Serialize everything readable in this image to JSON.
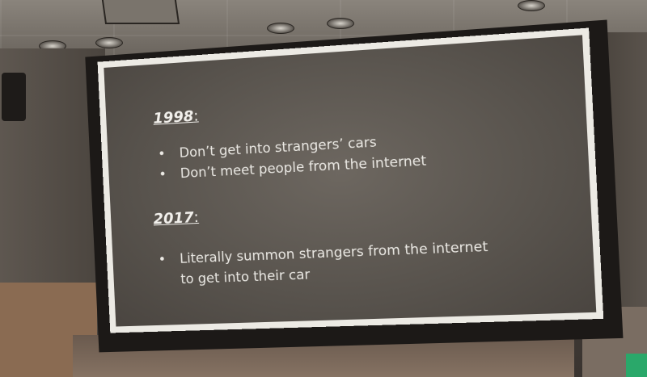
{
  "slide": {
    "section_1": {
      "year": "1998",
      "colon": ":",
      "bullets": [
        "Don’t get into strangers’ cars",
        "Don’t meet people from the internet"
      ]
    },
    "section_2": {
      "year": "2017",
      "colon": ":",
      "bullets": [
        "Literally summon strangers from the internet to get into their car"
      ]
    }
  },
  "colors": {
    "slide_background": "#5e5953",
    "slide_text": "#ebe9e4",
    "screen_frame": "#eceae4",
    "housing": "#1c1917"
  }
}
